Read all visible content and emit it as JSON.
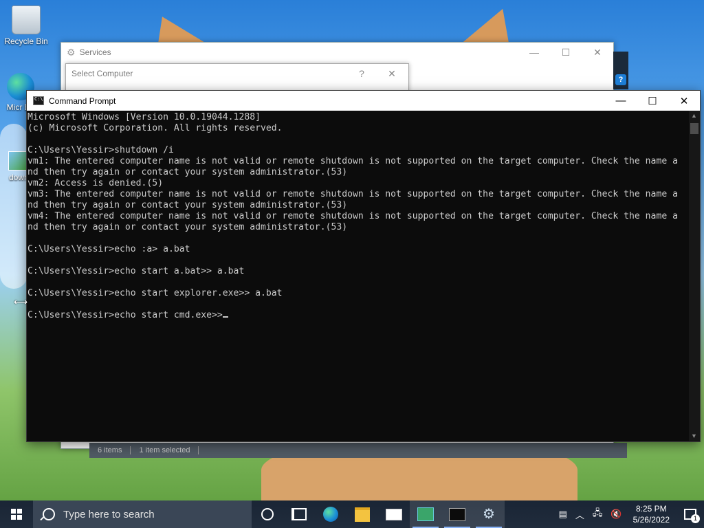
{
  "desktop": {
    "icons": [
      {
        "label": "Recycle Bin"
      },
      {
        "label": "Micr Ed"
      },
      {
        "label": "dowr"
      }
    ]
  },
  "services_window": {
    "title": "Services",
    "status": {
      "items": "6 items",
      "selected": "1 item selected"
    }
  },
  "select_computer": {
    "title": "Select Computer",
    "help": "?"
  },
  "cmd": {
    "title": "Command Prompt",
    "lines": [
      "Microsoft Windows [Version 10.0.19044.1288]",
      "(c) Microsoft Corporation. All rights reserved.",
      "",
      "C:\\Users\\Yessir>shutdown /i",
      "vm1: The entered computer name is not valid or remote shutdown is not supported on the target computer. Check the name a",
      "nd then try again or contact your system administrator.(53)",
      "vm2: Access is denied.(5)",
      "vm3: The entered computer name is not valid or remote shutdown is not supported on the target computer. Check the name a",
      "nd then try again or contact your system administrator.(53)",
      "vm4: The entered computer name is not valid or remote shutdown is not supported on the target computer. Check the name a",
      "nd then try again or contact your system administrator.(53)",
      "",
      "C:\\Users\\Yessir>echo :a> a.bat",
      "",
      "C:\\Users\\Yessir>echo start a.bat>> a.bat",
      "",
      "C:\\Users\\Yessir>echo start explorer.exe>> a.bat",
      "",
      "C:\\Users\\Yessir>echo start cmd.exe>>"
    ]
  },
  "taskbar": {
    "search_placeholder": "Type here to search",
    "time": "8:25 PM",
    "date": "5/26/2022",
    "notification_count": "1"
  }
}
